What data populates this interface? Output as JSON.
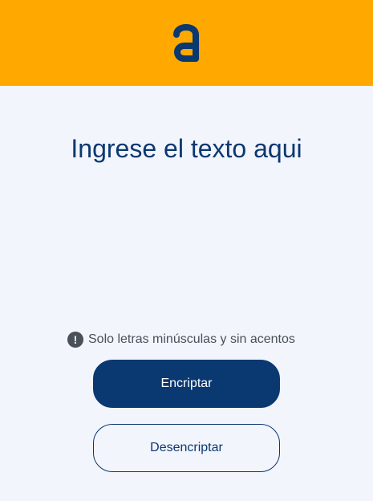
{
  "header": {
    "logo_icon": "alura-a-logo-icon",
    "background_color": "#ffa800"
  },
  "main": {
    "input": {
      "placeholder": "Ingrese el texto aqui",
      "value": ""
    },
    "hint": {
      "icon": "exclamation-circle-icon",
      "text": "Solo letras minúsculas y sin acentos"
    },
    "buttons": {
      "encrypt_label": "Encriptar",
      "decrypt_label": "Desencriptar"
    }
  },
  "colors": {
    "accent": "#0a3871",
    "background": "#f3f5fc",
    "hint": "#495057"
  }
}
